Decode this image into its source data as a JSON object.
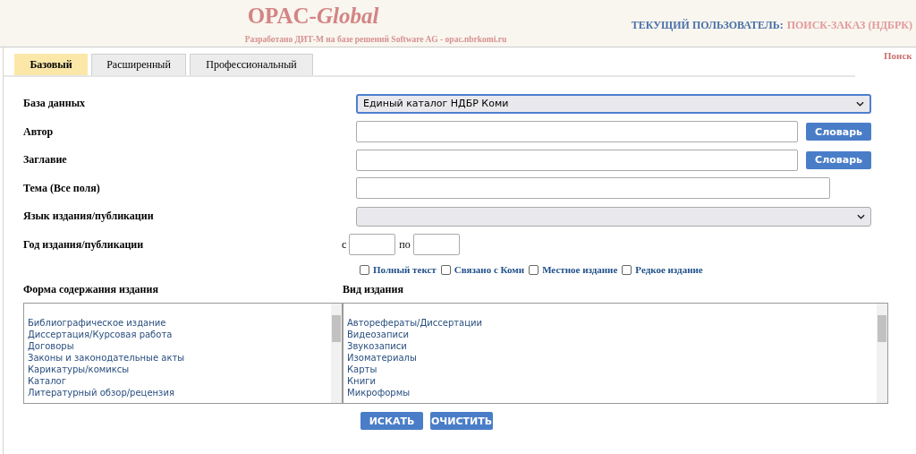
{
  "header": {
    "title": "OPAC-*Global*",
    "subtitle": "Разработано ДИТ-М на базе решений Software AG - opac.nbrkomi.ru",
    "user_label": "ТЕКУЩИЙ ПОЛЬЗОВАТЕЛЬ:",
    "user_value": "ПОИСК-ЗАКАЗ (НДБРК)"
  },
  "tabs": [
    {
      "label": "Базовый",
      "selected": true
    },
    {
      "label": "Расширенный",
      "selected": false
    },
    {
      "label": "Профессиональный",
      "selected": false
    }
  ],
  "side_link": "Поиск",
  "fields": [
    {
      "kind": "select",
      "label": "База данных",
      "value": "Единый каталог НДБР Коми",
      "focused": true
    },
    {
      "kind": "text",
      "label": "Автор",
      "button": "Словарь"
    },
    {
      "kind": "text",
      "label": "Заглавие",
      "button": "Словарь"
    },
    {
      "kind": "text",
      "label": "Тема (Все поля)"
    },
    {
      "kind": "select",
      "label": "Язык издания/публикации",
      "focused": false
    },
    {
      "kind": "range",
      "label": "Год издания/публикации",
      "from_label": "с",
      "to_label": "по"
    }
  ],
  "checkboxes": [
    {
      "label": "Полный текст",
      "checked": false
    },
    {
      "label": "Связано с Коми",
      "checked": false
    },
    {
      "label": "Местное издание",
      "checked": false
    },
    {
      "label": "Редкое издание",
      "checked": false
    }
  ],
  "lists": [
    {
      "label": "Форма содержания издания",
      "items": [
        "Библиографическое издание",
        "Диссертация/Курсовая работа",
        "Договоры",
        "Законы и законодательные акты",
        "Карикатуры/комиксы",
        "Каталог",
        "Литературный обзор/рецензия"
      ]
    },
    {
      "label": "Вид издания",
      "items": [
        "Авторефераты/Диссертации",
        "Видеозаписи",
        "Звукозаписи",
        "Изоматериалы",
        "Карты",
        "Книги",
        "Микроформы"
      ]
    }
  ],
  "buttons": [
    "ИСКАТЬ",
    "ОЧИСТИТЬ"
  ]
}
